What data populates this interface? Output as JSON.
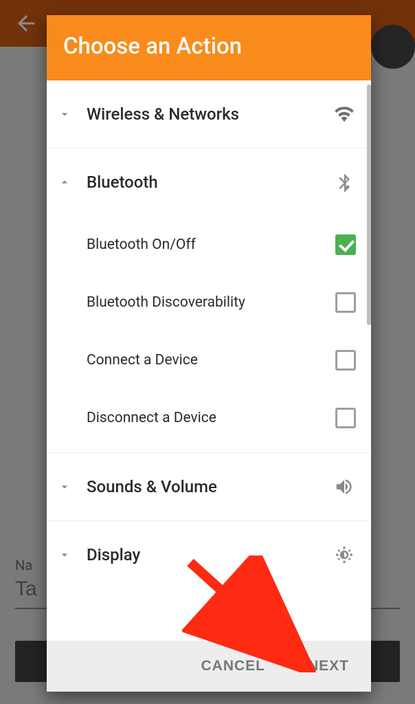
{
  "background": {
    "name_label": "Na",
    "name_placeholder": "Ta"
  },
  "modal": {
    "title": "Choose an Action",
    "sections": [
      {
        "label": "Wireless & Networks",
        "expanded": false,
        "icon": "wifi"
      },
      {
        "label": "Bluetooth",
        "expanded": true,
        "icon": "bluetooth",
        "items": [
          {
            "label": "Bluetooth On/Off",
            "checked": true
          },
          {
            "label": "Bluetooth Discoverability",
            "checked": false
          },
          {
            "label": "Connect a Device",
            "checked": false
          },
          {
            "label": "Disconnect a Device",
            "checked": false
          }
        ]
      },
      {
        "label": "Sounds & Volume",
        "expanded": false,
        "icon": "volume"
      },
      {
        "label": "Display",
        "expanded": false,
        "icon": "brightness"
      }
    ],
    "footer": {
      "cancel": "CANCEL",
      "next": "NEXT"
    }
  }
}
